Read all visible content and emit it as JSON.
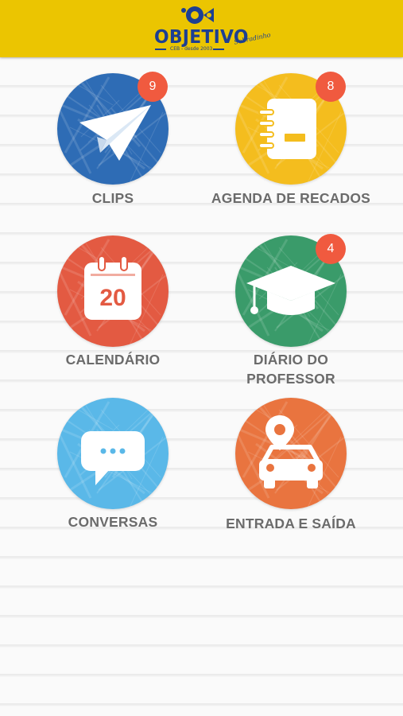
{
  "header": {
    "logo_text": "OBJETIVO",
    "logo_subtitle": "CEB - desde 2003",
    "logo_script": "Sobradinho",
    "background_color": "#ebc501",
    "brand_color": "#1d3f92"
  },
  "menu": [
    {
      "id": "clips",
      "label_lines": [
        "CLIPS"
      ],
      "badge": "9",
      "icon": "paper-plane-icon",
      "color": "#2e6cb5"
    },
    {
      "id": "agenda",
      "label_lines": [
        "AGENDA DE RECADOS"
      ],
      "badge": "8",
      "icon": "notebook-icon",
      "color": "#f4bd1e"
    },
    {
      "id": "calendario",
      "label_lines": [
        "CALENDÁRIO"
      ],
      "badge": "",
      "icon": "calendar-icon",
      "calendar_day": "20",
      "color": "#e35a42"
    },
    {
      "id": "diario",
      "label_lines": [
        "DIÁRIO DO",
        "PROFESSOR"
      ],
      "badge": "4",
      "icon": "graduation-cap-icon",
      "color": "#3a9b6a"
    },
    {
      "id": "conversas",
      "label_lines": [
        "CONVERSAS"
      ],
      "badge": "",
      "icon": "chat-bubble-icon",
      "color": "#5ab8e8"
    },
    {
      "id": "entrada",
      "label_lines": [
        "ENTRADA E SAÍDA"
      ],
      "badge": "",
      "icon": "car-location-icon",
      "color": "#e9743f"
    }
  ],
  "badge_color": "#f05a3f"
}
